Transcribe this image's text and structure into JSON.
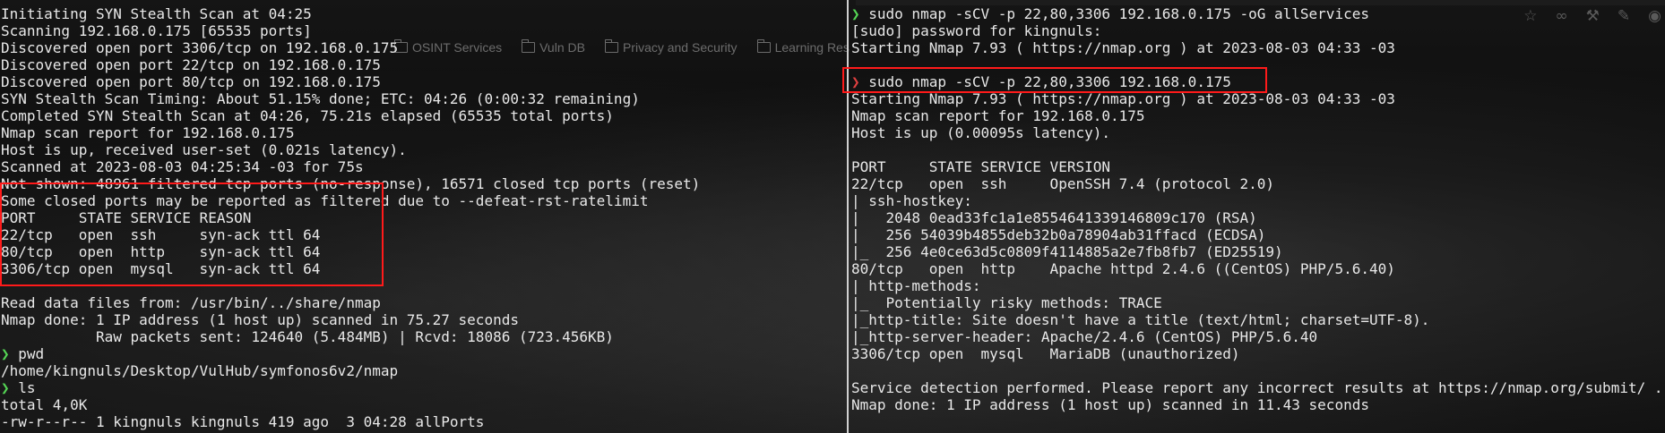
{
  "browser": {
    "bookmarks": [
      {
        "icon": "folder-icon",
        "label": "OSINT Services"
      },
      {
        "icon": "folder-icon",
        "label": "Vuln DB"
      },
      {
        "icon": "folder-icon",
        "label": "Privacy and Security"
      },
      {
        "icon": "folder-icon",
        "label": "Learning Res"
      }
    ],
    "toolbar_icons": [
      "star-icon",
      "infinity-icon",
      "wrench-icon",
      "extension-icon",
      "globe-icon",
      "menu-icon"
    ],
    "toolbar_glyphs": [
      "☆",
      "∞",
      "⚒",
      "✎",
      "◉",
      "☰"
    ]
  },
  "terminal_left": {
    "prompt_symbol": "❯",
    "lines": [
      "Initiating SYN Stealth Scan at 04:25",
      "Scanning 192.168.0.175 [65535 ports]",
      "Discovered open port 3306/tcp on 192.168.0.175",
      "Discovered open port 22/tcp on 192.168.0.175",
      "Discovered open port 80/tcp on 192.168.0.175",
      "SYN Stealth Scan Timing: About 51.15% done; ETC: 04:26 (0:00:32 remaining)",
      "Completed SYN Stealth Scan at 04:26, 75.21s elapsed (65535 total ports)",
      "Nmap scan report for 192.168.0.175",
      "Host is up, received user-set (0.021s latency).",
      "Scanned at 2023-08-03 04:25:34 -03 for 75s",
      "Not shown: 48961 filtered tcp ports (no-response), 16571 closed tcp ports (reset)",
      "Some closed ports may be reported as filtered due to --defeat-rst-ratelimit",
      "PORT     STATE SERVICE REASON",
      "22/tcp   open  ssh     syn-ack ttl 64",
      "80/tcp   open  http    syn-ack ttl 64",
      "3306/tcp open  mysql   syn-ack ttl 64",
      "",
      "Read data files from: /usr/bin/../share/nmap",
      "Nmap done: 1 IP address (1 host up) scanned in 75.27 seconds",
      "           Raw packets sent: 124640 (5.484MB) | Rcvd: 18086 (723.456KB)",
      "pwd",
      "/home/kingnuls/Desktop/VulHub/symfonos6v2/nmap",
      "ls",
      "total 4,0K",
      "-rw-r--r-- 1 kingnuls kingnuls 419 ago  3 04:28 allPorts"
    ]
  },
  "terminal_right": {
    "prompt_symbol": "❯",
    "lines": [
      "sudo nmap -sCV -p 22,80,3306 192.168.0.175 -oG allServices",
      "[sudo] password for kingnuls:",
      "Starting Nmap 7.93 ( https://nmap.org ) at 2023-08-03 04:33 -03",
      "",
      "sudo nmap -sCV -p 22,80,3306 192.168.0.175",
      "Starting Nmap 7.93 ( https://nmap.org ) at 2023-08-03 04:33 -03",
      "Nmap scan report for 192.168.0.175",
      "Host is up (0.00095s latency).",
      "",
      "PORT     STATE SERVICE VERSION",
      "22/tcp   open  ssh     OpenSSH 7.4 (protocol 2.0)",
      "| ssh-hostkey: ",
      "|   2048 0ead33fc1a1e8554641339146809c170 (RSA)",
      "|   256 54039b4855deb32b0a78904ab31ffacd (ECDSA)",
      "|_  256 4e0ce63d5c0809f4114885a2e7fb8fb7 (ED25519)",
      "80/tcp   open  http    Apache httpd 2.4.6 ((CentOS) PHP/5.6.40)",
      "| http-methods: ",
      "|_  Potentially risky methods: TRACE",
      "|_http-title: Site doesn't have a title (text/html; charset=UTF-8).",
      "|_http-server-header: Apache/2.4.6 (CentOS) PHP/5.6.40",
      "3306/tcp open  mysql   MariaDB (unauthorized)",
      "",
      "Service detection performed. Please report any incorrect results at https://nmap.org/submit/ .",
      "Nmap done: 1 IP address (1 host up) scanned in 11.43 seconds"
    ]
  },
  "colors": {
    "prompt_ok": "#55d655",
    "prompt_err": "#e04040",
    "highlight_box": "#ff1a1a",
    "text": "#e8e8e8",
    "divider": "#d0d0d0"
  }
}
